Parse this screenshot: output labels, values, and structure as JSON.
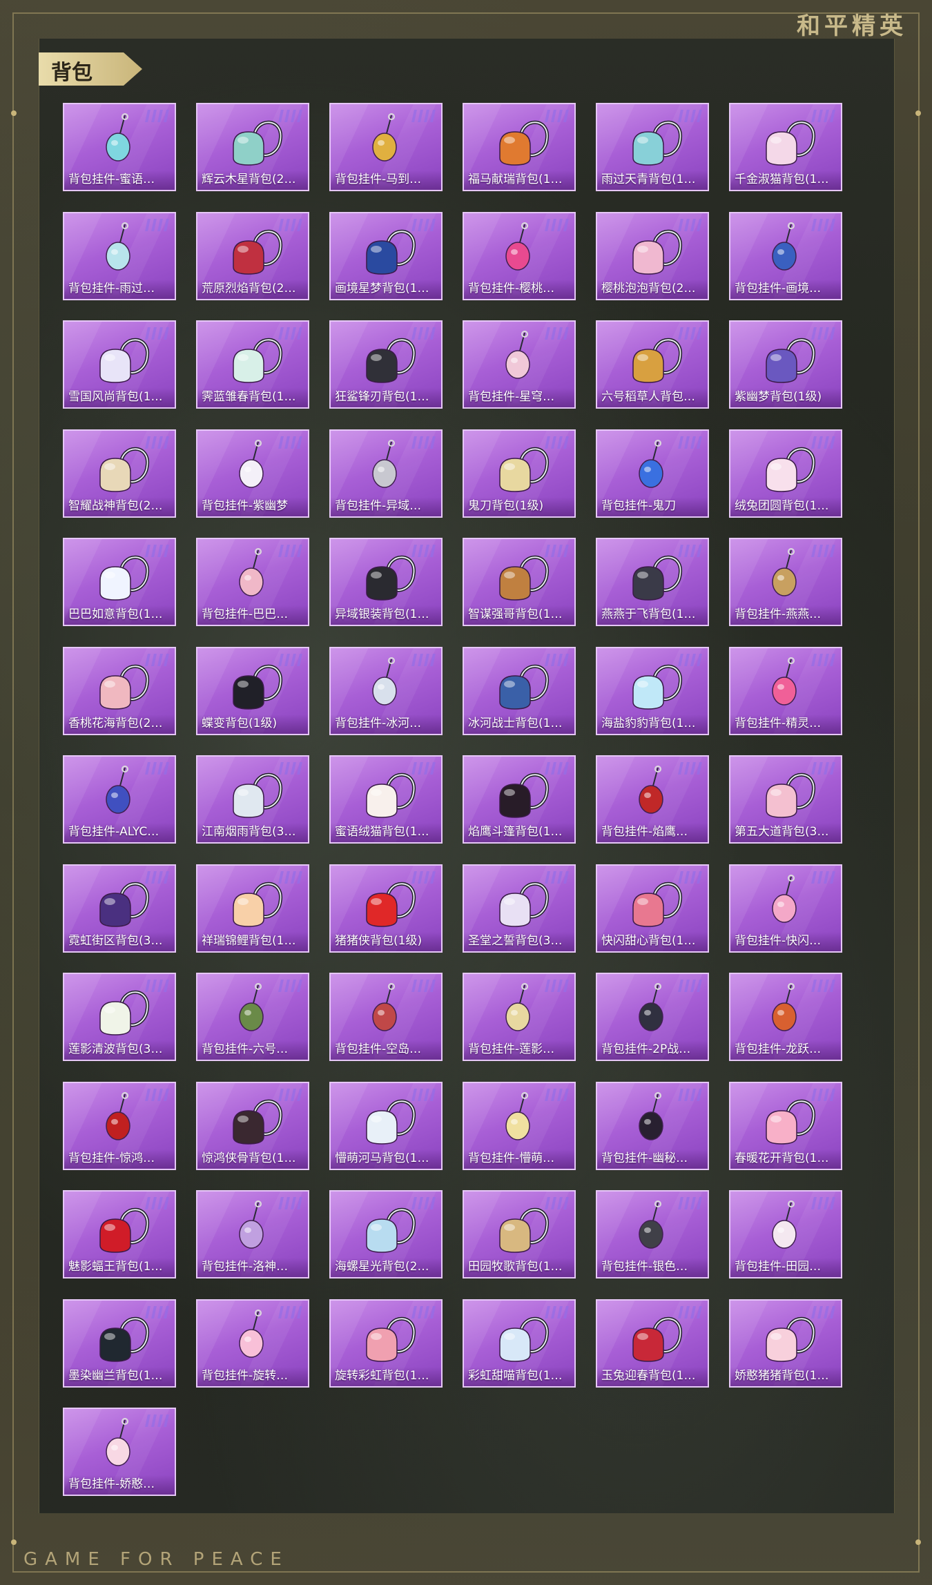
{
  "brand": {
    "top_right": "和平精英",
    "footer": "GAME FOR PEACE"
  },
  "panel": {
    "title": "背包"
  },
  "items": [
    {
      "label": "背包挂件-蜜语…",
      "icon": "heart-charm-icon",
      "color": "#7fd6e0"
    },
    {
      "label": "辉云木星背包(2…",
      "icon": "backpack-icon",
      "color": "#8fd0c8"
    },
    {
      "label": "背包挂件-马到…",
      "icon": "horse-charm-icon",
      "color": "#e0b040"
    },
    {
      "label": "福马献瑞背包(1…",
      "icon": "backpack-icon",
      "color": "#e07a30"
    },
    {
      "label": "雨过天青背包(1…",
      "icon": "backpack-icon",
      "color": "#88d0d8"
    },
    {
      "label": "千金淑猫背包(1…",
      "icon": "backpack-icon",
      "color": "#f4d8e8"
    },
    {
      "label": "背包挂件-雨过…",
      "icon": "key-charm-icon",
      "color": "#b8e4ec"
    },
    {
      "label": "荒原烈焰背包(2…",
      "icon": "backpack-icon",
      "color": "#c03040"
    },
    {
      "label": "画境星梦背包(1…",
      "icon": "backpack-icon",
      "color": "#2a4aa0"
    },
    {
      "label": "背包挂件-樱桃…",
      "icon": "cherry-charm-icon",
      "color": "#e84a90"
    },
    {
      "label": "樱桃泡泡背包(2…",
      "icon": "backpack-icon",
      "color": "#f0b8d0"
    },
    {
      "label": "背包挂件-画境…",
      "icon": "sword-charm-icon",
      "color": "#3a60c0"
    },
    {
      "label": "雪国风尚背包(1…",
      "icon": "backpack-icon",
      "color": "#e8e4f8"
    },
    {
      "label": "霁蓝雏春背包(1…",
      "icon": "backpack-icon",
      "color": "#d8f0e8"
    },
    {
      "label": "狂鲨锋刃背包(1…",
      "icon": "backpack-icon",
      "color": "#303038"
    },
    {
      "label": "背包挂件-星穹…",
      "icon": "bow-charm-icon",
      "color": "#f0c8d8"
    },
    {
      "label": "六号稻草人背包…",
      "icon": "backpack-icon",
      "color": "#d8a040"
    },
    {
      "label": "紫幽梦背包(1级)",
      "icon": "backpack-icon",
      "color": "#6a58c0"
    },
    {
      "label": "智耀战神背包(2…",
      "icon": "backpack-icon",
      "color": "#e8d8b8"
    },
    {
      "label": "背包挂件-紫幽梦",
      "icon": "umbrella-charm-icon",
      "color": "#f4f0f8"
    },
    {
      "label": "背包挂件-异域…",
      "icon": "wing-charm-icon",
      "color": "#c8c8d0"
    },
    {
      "label": "鬼刀背包(1级)",
      "icon": "backpack-icon",
      "color": "#e8d8a0"
    },
    {
      "label": "背包挂件-鬼刀",
      "icon": "crystal-charm-icon",
      "color": "#3a70e0"
    },
    {
      "label": "绒兔团圆背包(1…",
      "icon": "backpack-icon",
      "color": "#f8e0ec"
    },
    {
      "label": "巴巴如意背包(1…",
      "icon": "backpack-icon",
      "color": "#f0f4ff"
    },
    {
      "label": "背包挂件-巴巴…",
      "icon": "fox-charm-icon",
      "color": "#f0b8c8"
    },
    {
      "label": "异域银装背包(1…",
      "icon": "backpack-icon",
      "color": "#2a2a30"
    },
    {
      "label": "智谋强哥背包(1…",
      "icon": "backpack-icon",
      "color": "#c08040"
    },
    {
      "label": "燕燕于飞背包(1…",
      "icon": "backpack-icon",
      "color": "#3a3a48"
    },
    {
      "label": "背包挂件-燕燕…",
      "icon": "bird-charm-icon",
      "color": "#c8a060"
    },
    {
      "label": "香桃花海背包(2…",
      "icon": "backpack-icon",
      "color": "#f0b8c0"
    },
    {
      "label": "蝶变背包(1级)",
      "icon": "backpack-icon",
      "color": "#202028"
    },
    {
      "label": "背包挂件-冰河…",
      "icon": "robot-charm-icon",
      "color": "#d8e0ec"
    },
    {
      "label": "冰河战士背包(1…",
      "icon": "backpack-icon",
      "color": "#3a60a8"
    },
    {
      "label": "海盐豹豹背包(1…",
      "icon": "backpack-icon",
      "color": "#c0e8f8"
    },
    {
      "label": "背包挂件-精灵…",
      "icon": "winged-heart-charm-icon",
      "color": "#f06098"
    },
    {
      "label": "背包挂件-ALYC…",
      "icon": "gem-charm-icon",
      "color": "#4050c0"
    },
    {
      "label": "江南烟雨背包(3…",
      "icon": "backpack-icon",
      "color": "#e0e8f0"
    },
    {
      "label": "蜜语绒猫背包(1…",
      "icon": "backpack-icon",
      "color": "#f8f0ec"
    },
    {
      "label": "焰鹰斗篷背包(1…",
      "icon": "backpack-icon",
      "color": "#281c28"
    },
    {
      "label": "背包挂件-焰鹰…",
      "icon": "knot-charm-icon",
      "color": "#c02828"
    },
    {
      "label": "第五大道背包(3…",
      "icon": "backpack-icon",
      "color": "#f4c0d0"
    },
    {
      "label": "霓虹街区背包(3…",
      "icon": "backpack-icon",
      "color": "#4a3080"
    },
    {
      "label": "祥瑞锦鲤背包(1…",
      "icon": "backpack-icon",
      "color": "#f8d0a8"
    },
    {
      "label": "猪猪侠背包(1级)",
      "icon": "backpack-icon",
      "color": "#e02828"
    },
    {
      "label": "圣堂之誓背包(3…",
      "icon": "backpack-icon",
      "color": "#e8e0f4"
    },
    {
      "label": "快闪甜心背包(1…",
      "icon": "backpack-icon",
      "color": "#e87890"
    },
    {
      "label": "背包挂件-快闪…",
      "icon": "donut-charm-icon",
      "color": "#f4a8c8"
    },
    {
      "label": "莲影清波背包(3…",
      "icon": "backpack-icon",
      "color": "#f0f4e8"
    },
    {
      "label": "背包挂件-六号…",
      "icon": "bell-charm-icon",
      "color": "#6a8a48"
    },
    {
      "label": "背包挂件-空岛…",
      "icon": "chili-charm-icon",
      "color": "#c04848"
    },
    {
      "label": "背包挂件-莲影…",
      "icon": "tassel-charm-icon",
      "color": "#e8d8a0"
    },
    {
      "label": "背包挂件-2P战…",
      "icon": "blade-charm-icon",
      "color": "#303040"
    },
    {
      "label": "背包挂件-龙跃…",
      "icon": "lion-charm-icon",
      "color": "#d86030"
    },
    {
      "label": "背包挂件-惊鸿…",
      "icon": "tassel-charm-icon",
      "color": "#c02020"
    },
    {
      "label": "惊鸿侠骨背包(1…",
      "icon": "backpack-icon",
      "color": "#3a2830"
    },
    {
      "label": "懵萌河马背包(1…",
      "icon": "backpack-icon",
      "color": "#e8f0f8"
    },
    {
      "label": "背包挂件-懵萌…",
      "icon": "heart-charm-icon",
      "color": "#f0e0a0"
    },
    {
      "label": "背包挂件-幽秘…",
      "icon": "bat-charm-icon",
      "color": "#282030"
    },
    {
      "label": "春暖花开背包(1…",
      "icon": "backpack-icon",
      "color": "#f8b0c8"
    },
    {
      "label": "魅影蝠王背包(1…",
      "icon": "backpack-icon",
      "color": "#d01c28"
    },
    {
      "label": "背包挂件-洛神…",
      "icon": "bow-charm-icon",
      "color": "#c0a0e0"
    },
    {
      "label": "海螺星光背包(2…",
      "icon": "backpack-icon",
      "color": "#b8dcf0"
    },
    {
      "label": "田园牧歌背包(1…",
      "icon": "backpack-icon",
      "color": "#d8b880"
    },
    {
      "label": "背包挂件-银色…",
      "icon": "mouse-charm-icon",
      "color": "#404048"
    },
    {
      "label": "背包挂件-田园…",
      "icon": "card-charm-icon",
      "color": "#f4e8f0"
    },
    {
      "label": "墨染幽兰背包(1…",
      "icon": "backpack-icon",
      "color": "#202830"
    },
    {
      "label": "背包挂件-旋转…",
      "icon": "unicorn-charm-icon",
      "color": "#f8c0d8"
    },
    {
      "label": "旋转彩虹背包(1…",
      "icon": "backpack-icon",
      "color": "#f0a0b0"
    },
    {
      "label": "彩虹甜喵背包(1…",
      "icon": "backpack-icon",
      "color": "#d8e8f8"
    },
    {
      "label": "玉兔迎春背包(1…",
      "icon": "backpack-icon",
      "color": "#c82838"
    },
    {
      "label": "娇憨猪猪背包(1…",
      "icon": "backpack-icon",
      "color": "#f8d0dc"
    },
    {
      "label": "背包挂件-娇憨…",
      "icon": "pig-charm-icon",
      "color": "#f8d8e4"
    }
  ]
}
